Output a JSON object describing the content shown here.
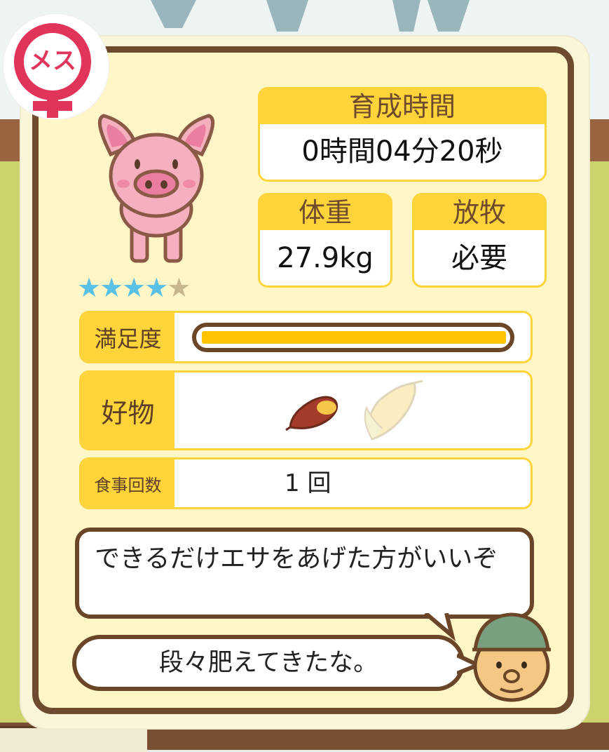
{
  "gender_badge": {
    "label": "メス"
  },
  "stars": {
    "filled": 4,
    "total": 5,
    "filled_color": "#5bc0e6",
    "empty_color": "#c8b78e"
  },
  "stats": {
    "growth_time": {
      "label": "育成時間",
      "value": "0時間04分20秒"
    },
    "weight": {
      "label": "体重",
      "value": "27.9kg"
    },
    "grazing": {
      "label": "放牧",
      "value": "必要"
    }
  },
  "satisfaction": {
    "label": "満足度",
    "level": 1.0,
    "bar_color": "#ffc400"
  },
  "favorites": {
    "label": "好物",
    "items": [
      "sweet-potato-icon",
      "corn-icon"
    ]
  },
  "meal_count": {
    "label": "食事回数",
    "value": "1 回"
  },
  "messages": {
    "advice": "できるだけエサをあげた方がいいぞ",
    "comment": "段々肥えてきたな。"
  },
  "colors": {
    "accent": "#ffd33a",
    "frame": "#6e4a2e",
    "panel": "#fff6c8",
    "badge": "#e0345a"
  }
}
